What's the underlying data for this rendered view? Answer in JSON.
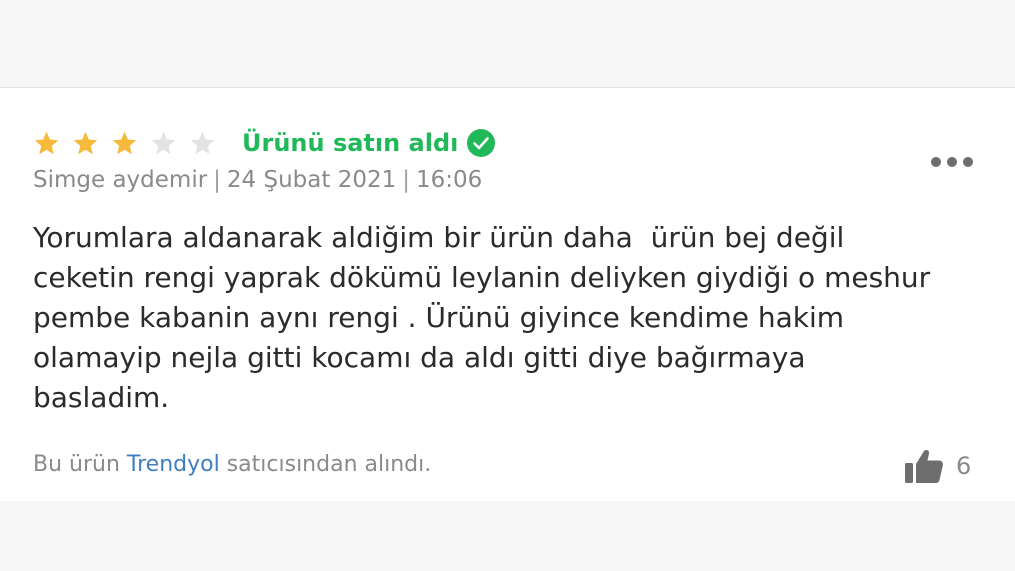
{
  "review": {
    "rating": 3,
    "rating_max": 5,
    "star_filled_color": "#f7b93a",
    "star_empty_color": "#e3e3e3",
    "purchase_label": "Ürünü satın aldı",
    "purchase_color": "#21b85a",
    "author": "Simge aydemir",
    "date": "24 Şubat 2021",
    "time": "16:06",
    "separator": "|",
    "text": "Yorumlara aldanarak aldiğim bir ürün daha  ürün bej değil\nceketin rengi yaprak dökümü leylanin deliyken giydiği o meshur\npembe kabanin aynı rengi . Ürünü giyince kendime hakim\nolamayip nejla gitti kocamı da aldı gitti diye bağırmaya\nbasladim.",
    "seller_prefix": "Bu ürün",
    "seller_name": "Trendyol",
    "seller_suffix": "satıcısından alındı.",
    "seller_link_color": "#3f7fc1",
    "like_count": "6",
    "icons": {
      "verified": "check-circle-icon",
      "more": "more-horizontal-icon",
      "like": "thumbs-up-icon"
    }
  }
}
